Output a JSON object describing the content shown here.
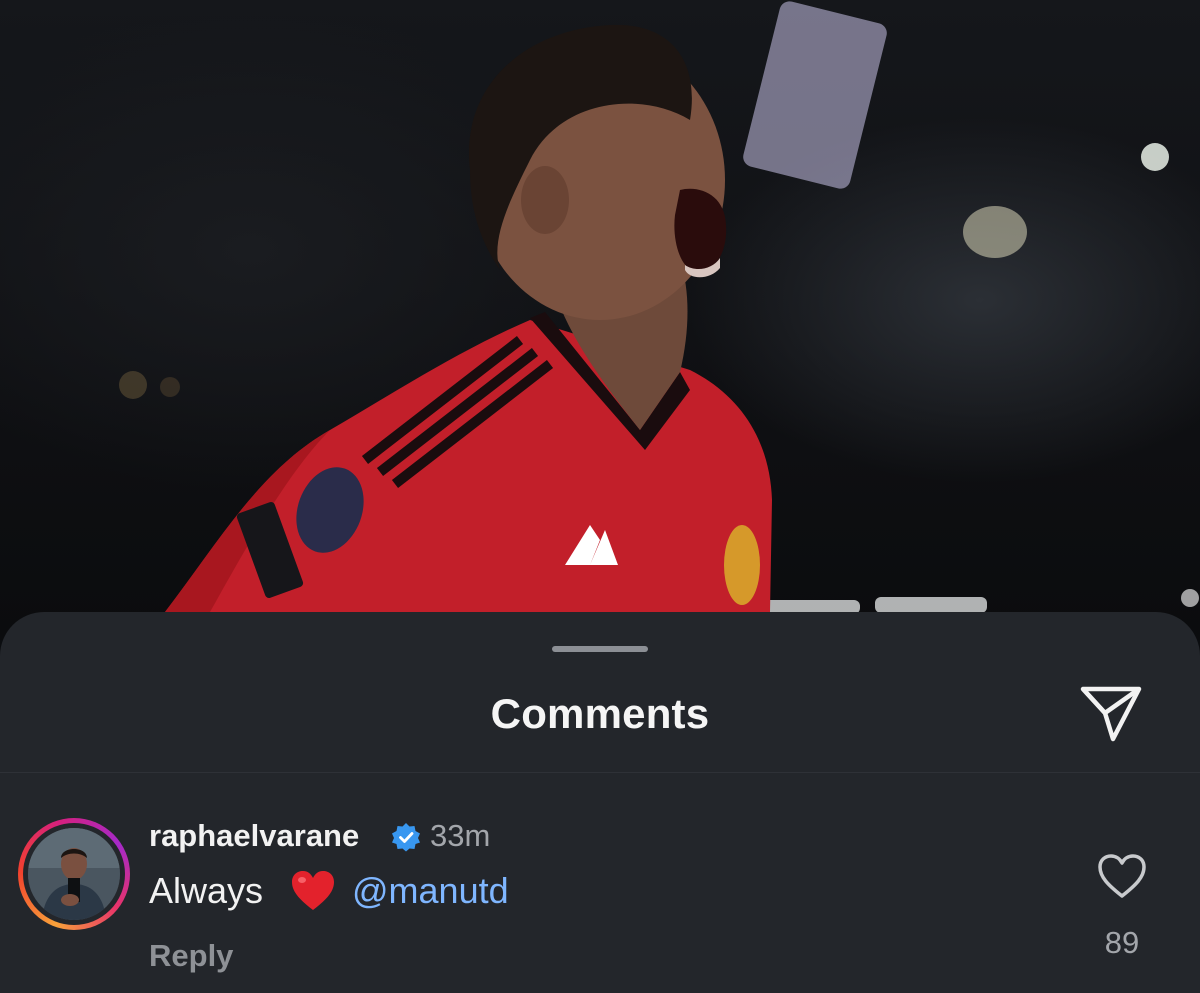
{
  "sheet": {
    "title": "Comments"
  },
  "comment": {
    "username": "raphaelvarane",
    "timestamp": "33m",
    "text": "Always",
    "emoji": "red-heart-emoji",
    "mention": "@manutd",
    "reply_label": "Reply",
    "like_count": "89"
  },
  "icons": {
    "share": "paper-plane-icon",
    "like": "heart-outline-icon",
    "verified": "verified-badge-icon"
  },
  "colors": {
    "sheet_bg": "#23262b",
    "mention": "#7fb6ff",
    "verified_blue": "#3897f0",
    "jersey_red": "#c8202a"
  }
}
